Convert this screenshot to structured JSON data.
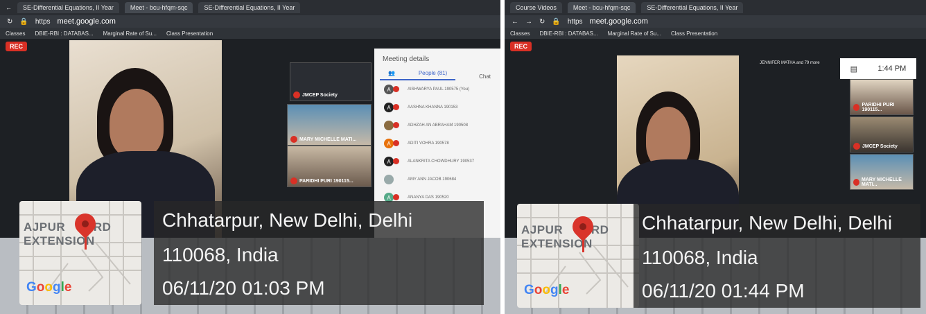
{
  "photos": [
    {
      "browser": {
        "tabs": [
          "SE-Differential Equations, II Year",
          "Meet - bcu-hfqm-sqc",
          "SE-Differential Equations, II Year"
        ],
        "url_prefix": "https",
        "url": "meet.google.com",
        "bookmarks": [
          "Classes",
          "DBIE-RBI : DATABAS...",
          "Marginal Rate of Su...",
          "Class Presentation"
        ]
      },
      "rec_label": "REC",
      "tiles": [
        "JMCEP Society",
        "MARY MICHELLE MATI...",
        "PARIDHI PURI 190115..."
      ],
      "panel": {
        "title": "Meeting details",
        "people_tab": "People (81)",
        "chat_tab": "Chat",
        "people": [
          {
            "initial": "A",
            "name": "AISHWARYA PAUL 190575 (You)"
          },
          {
            "initial": "A",
            "name": "AASHNA KHANNA 190153"
          },
          {
            "initial": "",
            "name": "ADHZAH AN ABRAHAM 190508"
          },
          {
            "initial": "A",
            "name": "ADITI VOHRA 190578"
          },
          {
            "initial": "A",
            "name": "ALANKRITA CHOWDHURY 190537"
          },
          {
            "initial": "",
            "name": "AMY ANN JACOB 190684"
          },
          {
            "initial": "A",
            "name": "ANANYA DAS 190520"
          }
        ]
      },
      "overlay": {
        "map_place_line1": "AJPUR",
        "map_place_line1b": "URD",
        "map_place_line2": "EXTENSION",
        "map_brand": "Google",
        "address_line1": "Chhatarpur, New Delhi, Delhi",
        "address_line2": "110068, India",
        "timestamp": "06/11/20 01:03 PM"
      }
    },
    {
      "browser": {
        "tabs": [
          "Course Videos",
          "Meet - bcu-hfqm-sqc",
          "SE-Differential Equations, II Year"
        ],
        "url_prefix": "https",
        "url": "meet.google.com",
        "bookmarks": [
          "Classes",
          "DBIE-RBI : DATABAS...",
          "Marginal Rate of Su...",
          "Class Presentation"
        ]
      },
      "rec_label": "REC",
      "joined": "JENNIFER MATHA and 79 more",
      "clock": "1:44 PM",
      "tiles": [
        "PARIDHI PURI 190115...",
        "JMCEP Society",
        "MARY MICHELLE MATI..."
      ],
      "overlay": {
        "map_place_line1": "AJPUR",
        "map_place_line1b": "URD",
        "map_place_line2": "EXTENSION",
        "map_brand": "Google",
        "address_line1": "Chhatarpur, New Delhi, Delhi",
        "address_line2": "110068, India",
        "timestamp": "06/11/20 01:44 PM"
      }
    }
  ],
  "colors": {
    "google_blue": "#4285f4",
    "google_red": "#ea4335",
    "google_yellow": "#fbbc05",
    "google_green": "#34a853",
    "rec_red": "#d93025"
  }
}
